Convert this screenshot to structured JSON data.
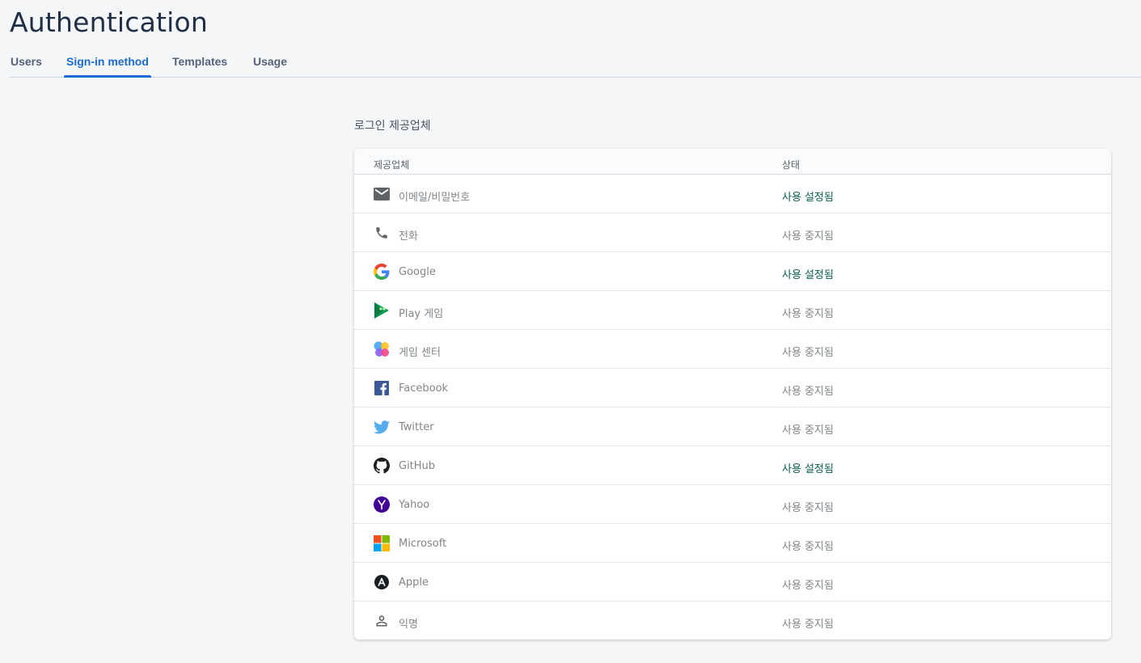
{
  "page": {
    "title": "Authentication"
  },
  "tabs": [
    {
      "label": "Users"
    },
    {
      "label": "Sign-in method"
    },
    {
      "label": "Templates"
    },
    {
      "label": "Usage"
    }
  ],
  "section_title": "로그인 제공업체",
  "table": {
    "headers": {
      "provider": "제공업체",
      "status": "상태"
    },
    "rows": [
      {
        "icon": "email-icon",
        "name": "이메일/비밀번호",
        "status": "사용 설정됨"
      },
      {
        "icon": "phone-icon",
        "name": "전화",
        "status": "사용 중지됨"
      },
      {
        "icon": "google-icon",
        "name": "Google",
        "status": "사용 설정됨"
      },
      {
        "icon": "play-games-icon",
        "name": "Play 게임",
        "status": "사용 중지됨"
      },
      {
        "icon": "game-center-icon",
        "name": "게임 센터",
        "status": "사용 중지됨"
      },
      {
        "icon": "facebook-icon",
        "name": "Facebook",
        "status": "사용 중지됨"
      },
      {
        "icon": "twitter-icon",
        "name": "Twitter",
        "status": "사용 중지됨"
      },
      {
        "icon": "github-icon",
        "name": "GitHub",
        "status": "사용 설정됨"
      },
      {
        "icon": "yahoo-icon",
        "name": "Yahoo",
        "status": "사용 중지됨"
      },
      {
        "icon": "microsoft-icon",
        "name": "Microsoft",
        "status": "사용 중지됨"
      },
      {
        "icon": "apple-icon",
        "name": "Apple",
        "status": "사용 중지됨"
      },
      {
        "icon": "anonymous-user-icon",
        "name": "익명",
        "status": "사용 중지됨"
      }
    ]
  },
  "colors": {
    "accent": "#1a6bd0",
    "enabled_status": "#0b5e52",
    "disabled_status": "#80868b"
  }
}
